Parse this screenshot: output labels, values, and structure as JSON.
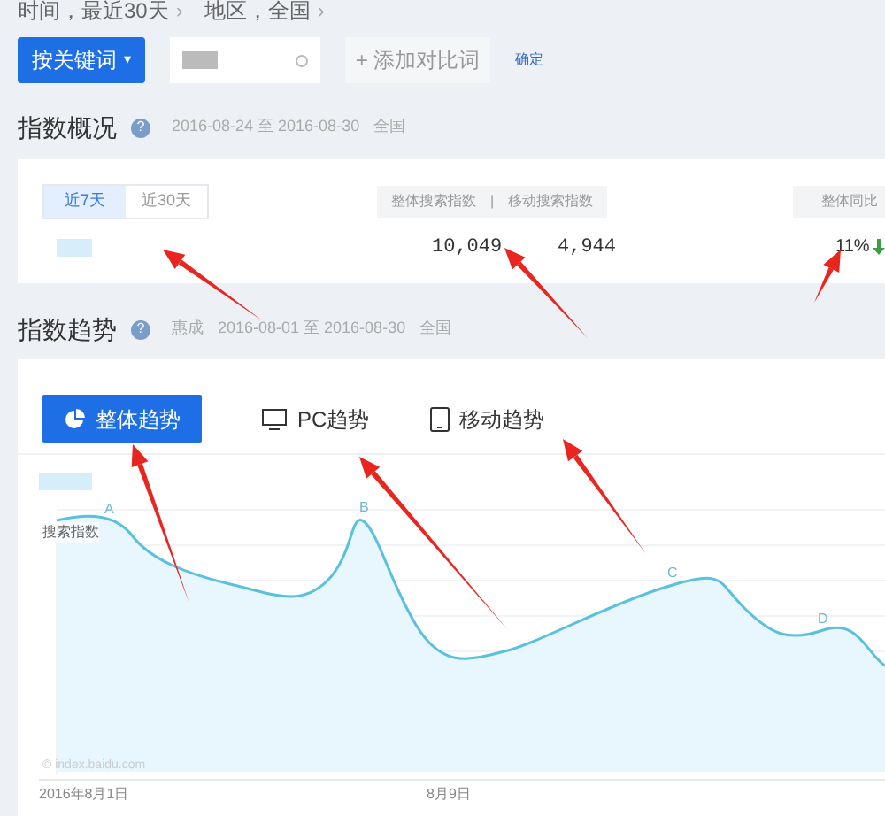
{
  "filters": [
    {
      "label": "时间，最近30天",
      "chevron": "›"
    },
    {
      "label": "地区，全国",
      "chevron": "›"
    }
  ],
  "search": {
    "mode_button": "按关键词",
    "caret": "▾",
    "add_button": "+ 添加对比词",
    "confirm": "确定"
  },
  "overview": {
    "title": "指数概况",
    "help": "?",
    "date_range": "2016-08-24 至 2016-08-30",
    "region": "全国",
    "tabs": [
      {
        "label": "近7天",
        "selected": true
      },
      {
        "label": "近30天",
        "selected": false
      }
    ],
    "headers": [
      "整体搜索指数",
      "移动搜索指数"
    ],
    "header_separator": "|",
    "yoy_header": "整体同比",
    "values": [
      "10,049",
      "4,944"
    ],
    "yoy_value": "11%"
  },
  "trend": {
    "title": "指数趋势",
    "help": "?",
    "keyword": "惠成",
    "date_range": "2016-08-01 至 2016-08-30",
    "region": "全国",
    "tabs": [
      {
        "label": "整体趋势",
        "kind": "overall",
        "selected": true
      },
      {
        "label": "PC趋势",
        "kind": "pc",
        "selected": false
      },
      {
        "label": "移动趋势",
        "kind": "mobile",
        "selected": false
      }
    ],
    "y_label": "搜索指数",
    "points": [
      "A",
      "B",
      "C",
      "D"
    ],
    "credit": "© index.baidu.com",
    "x_labels": [
      "2016年8月1日",
      "8月9日"
    ]
  }
}
